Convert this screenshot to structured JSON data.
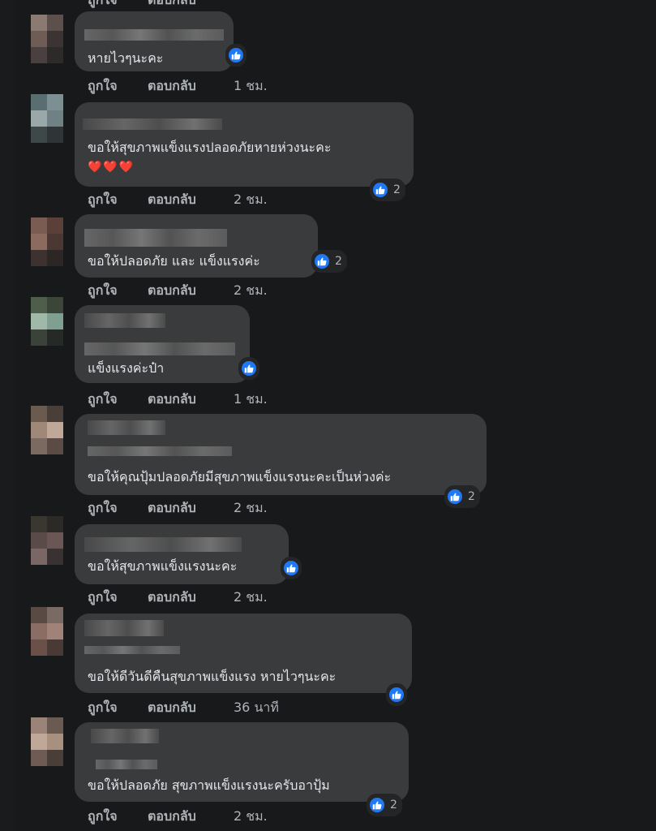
{
  "actions": {
    "like": "ถูกใจ",
    "reply": "ตอบกลับ"
  },
  "top_partial": {
    "like": "ถูกใจ",
    "reply": "ตอบกลับ"
  },
  "comments": [
    {
      "text": "หายไวๆนะคะ",
      "time": "1 ชม.",
      "reactions": ""
    },
    {
      "text": "ขอให้สุขภาพแข็งแรงปลอดภัยหายห่วงนะคะ",
      "extra": "❤️❤️❤️",
      "time": "2 ชม.",
      "reactions": "2"
    },
    {
      "text": "ขอให้ปลอดภัย และ แข็งแรงค่ะ",
      "time": "2 ชม.",
      "reactions": "2"
    },
    {
      "text": "แข็งแรงค่ะป๋า",
      "time": "1 ชม.",
      "reactions": ""
    },
    {
      "text": "ขอให้คุณปุ้มปลอดภัยมีสุขภาพแข็งแรงนะคะเป็นห่วงค่ะ",
      "time": "2 ชม.",
      "reactions": "2"
    },
    {
      "text": "ขอให้สุขภาพแข็งแรงนะคะ",
      "time": "2 ชม.",
      "reactions": ""
    },
    {
      "text": "ขอให้ดีวันดีคืนสุขภาพแข็งแรง หายไวๆนะคะ",
      "time": "36 นาที",
      "reactions": ""
    },
    {
      "text": "ขอให้ปลอดภัย สุขภาพแข็งแรงนะครับอาปุ้ม",
      "time": "2 ชม.",
      "reactions": "2"
    }
  ],
  "colors": {
    "background": "#18191a",
    "bubble": "#3a3b3c",
    "like_blue": "#2078f4",
    "meta_text": "#b0b3b8"
  }
}
